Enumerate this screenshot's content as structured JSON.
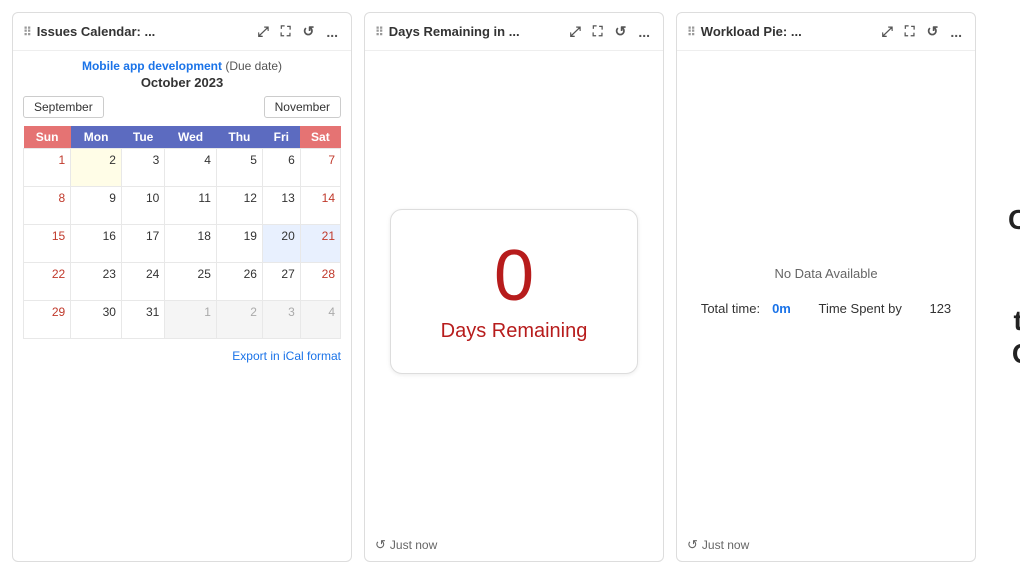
{
  "panels": {
    "calendar": {
      "drag_handle": "⠿",
      "title": "Issues Calendar: ...",
      "expand_icon": "⤢",
      "fullscreen_icon": "⛶",
      "refresh_icon": "↺",
      "more_icon": "...",
      "project_name": "Mobile app development",
      "project_type": "(Due date)",
      "month_year": "October 2023",
      "nav_prev": "September",
      "nav_next": "November",
      "weekdays": [
        "Sun",
        "Mon",
        "Tue",
        "Wed",
        "Thu",
        "Fri",
        "Sat"
      ],
      "export_label": "Export in iCal format",
      "weeks": [
        [
          {
            "day": "1",
            "type": "sun"
          },
          {
            "day": "2",
            "type": "mon today"
          },
          {
            "day": "3",
            "type": ""
          },
          {
            "day": "4",
            "type": ""
          },
          {
            "day": "5",
            "type": ""
          },
          {
            "day": "6",
            "type": ""
          },
          {
            "day": "7",
            "type": "sat"
          }
        ],
        [
          {
            "day": "8",
            "type": "sun"
          },
          {
            "day": "9",
            "type": ""
          },
          {
            "day": "10",
            "type": ""
          },
          {
            "day": "11",
            "type": ""
          },
          {
            "day": "12",
            "type": ""
          },
          {
            "day": "13",
            "type": ""
          },
          {
            "day": "14",
            "type": "sat"
          }
        ],
        [
          {
            "day": "15",
            "type": "sun"
          },
          {
            "day": "16",
            "type": ""
          },
          {
            "day": "17",
            "type": ""
          },
          {
            "day": "18",
            "type": ""
          },
          {
            "day": "19",
            "type": ""
          },
          {
            "day": "20",
            "type": "highlight"
          },
          {
            "day": "21",
            "type": "sat highlight"
          }
        ],
        [
          {
            "day": "22",
            "type": "sun"
          },
          {
            "day": "23",
            "type": ""
          },
          {
            "day": "24",
            "type": ""
          },
          {
            "day": "25",
            "type": ""
          },
          {
            "day": "26",
            "type": ""
          },
          {
            "day": "27",
            "type": ""
          },
          {
            "day": "28",
            "type": "sat"
          }
        ],
        [
          {
            "day": "29",
            "type": "sun"
          },
          {
            "day": "30",
            "type": ""
          },
          {
            "day": "31",
            "type": ""
          },
          {
            "day": "1",
            "type": "other-month"
          },
          {
            "day": "2",
            "type": "other-month"
          },
          {
            "day": "3",
            "type": "other-month sat"
          },
          {
            "day": "4",
            "type": "other-month sat"
          }
        ]
      ]
    },
    "days_remaining": {
      "drag_handle": "⠿",
      "title": "Days Remaining in ...",
      "expand_icon": "⤢",
      "fullscreen_icon": "⛶",
      "refresh_icon": "↺",
      "more_icon": "...",
      "count": "0",
      "label": "Days Remaining",
      "footer_refresh": "↺",
      "footer_time": "Just now"
    },
    "workload": {
      "drag_handle": "⠿",
      "title": "Workload Pie: ...",
      "expand_icon": "⤢",
      "fullscreen_icon": "⛶",
      "refresh_icon": "↺",
      "more_icon": "...",
      "no_data": "No Data Available",
      "total_time_label": "Total time:",
      "total_time_value": "0m",
      "time_spent_label": "Time Spent by",
      "time_spent_value": "123",
      "footer_refresh": "↺",
      "footer_time": "Just now"
    }
  },
  "sidebar_text": {
    "line1": "Calendar and Time-",
    "line2": "tracking Gadgets"
  }
}
